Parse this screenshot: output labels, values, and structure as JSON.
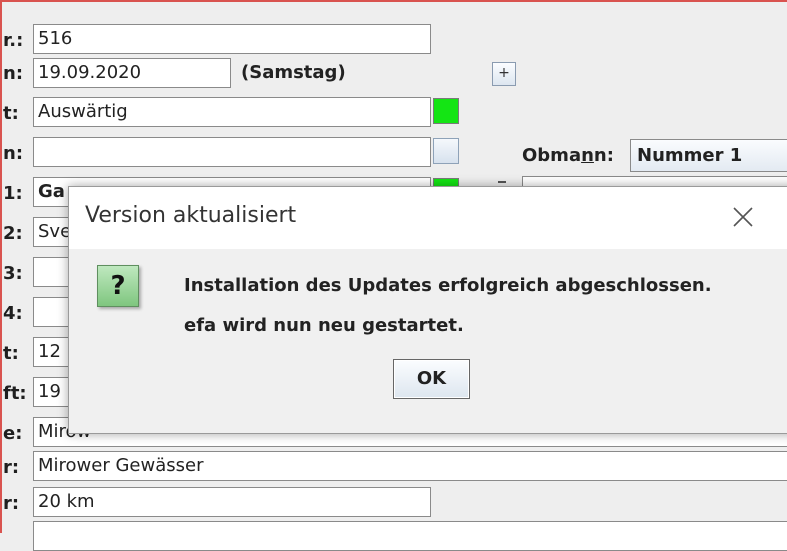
{
  "form": {
    "rows": [
      {
        "label": "r.:",
        "value": "516"
      },
      {
        "label": "n:",
        "value": "19.09.2020"
      },
      {
        "label": "t:",
        "value": "Auswärtig"
      },
      {
        "label": "n:",
        "value": ""
      },
      {
        "label": "1:",
        "value": "Ga"
      },
      {
        "label": "2:",
        "value": "Sve"
      },
      {
        "label": "3:",
        "value": ""
      },
      {
        "label": "4:",
        "value": ""
      },
      {
        "label": "t:",
        "value": "12"
      },
      {
        "label": "ft:",
        "value": "19"
      },
      {
        "label": "e:",
        "value": "Mirow"
      },
      {
        "label": "r:",
        "value": "Mirower Gewässer"
      },
      {
        "label": "r:",
        "value": "20 km"
      },
      {
        "label": "",
        "value": ""
      }
    ],
    "day_name": "(Samstag)",
    "plus_label": "+",
    "obmann": {
      "label_pre": "Obma",
      "label_u": "n",
      "label_post": "n:",
      "value": "Nummer 1"
    }
  },
  "dialog": {
    "title": "Version aktualisiert",
    "icon_symbol": "?",
    "message_line1": "Installation des Updates erfolgreich abgeschlossen.",
    "message_line2": "efa wird nun neu gestartet.",
    "ok_label": "OK"
  }
}
